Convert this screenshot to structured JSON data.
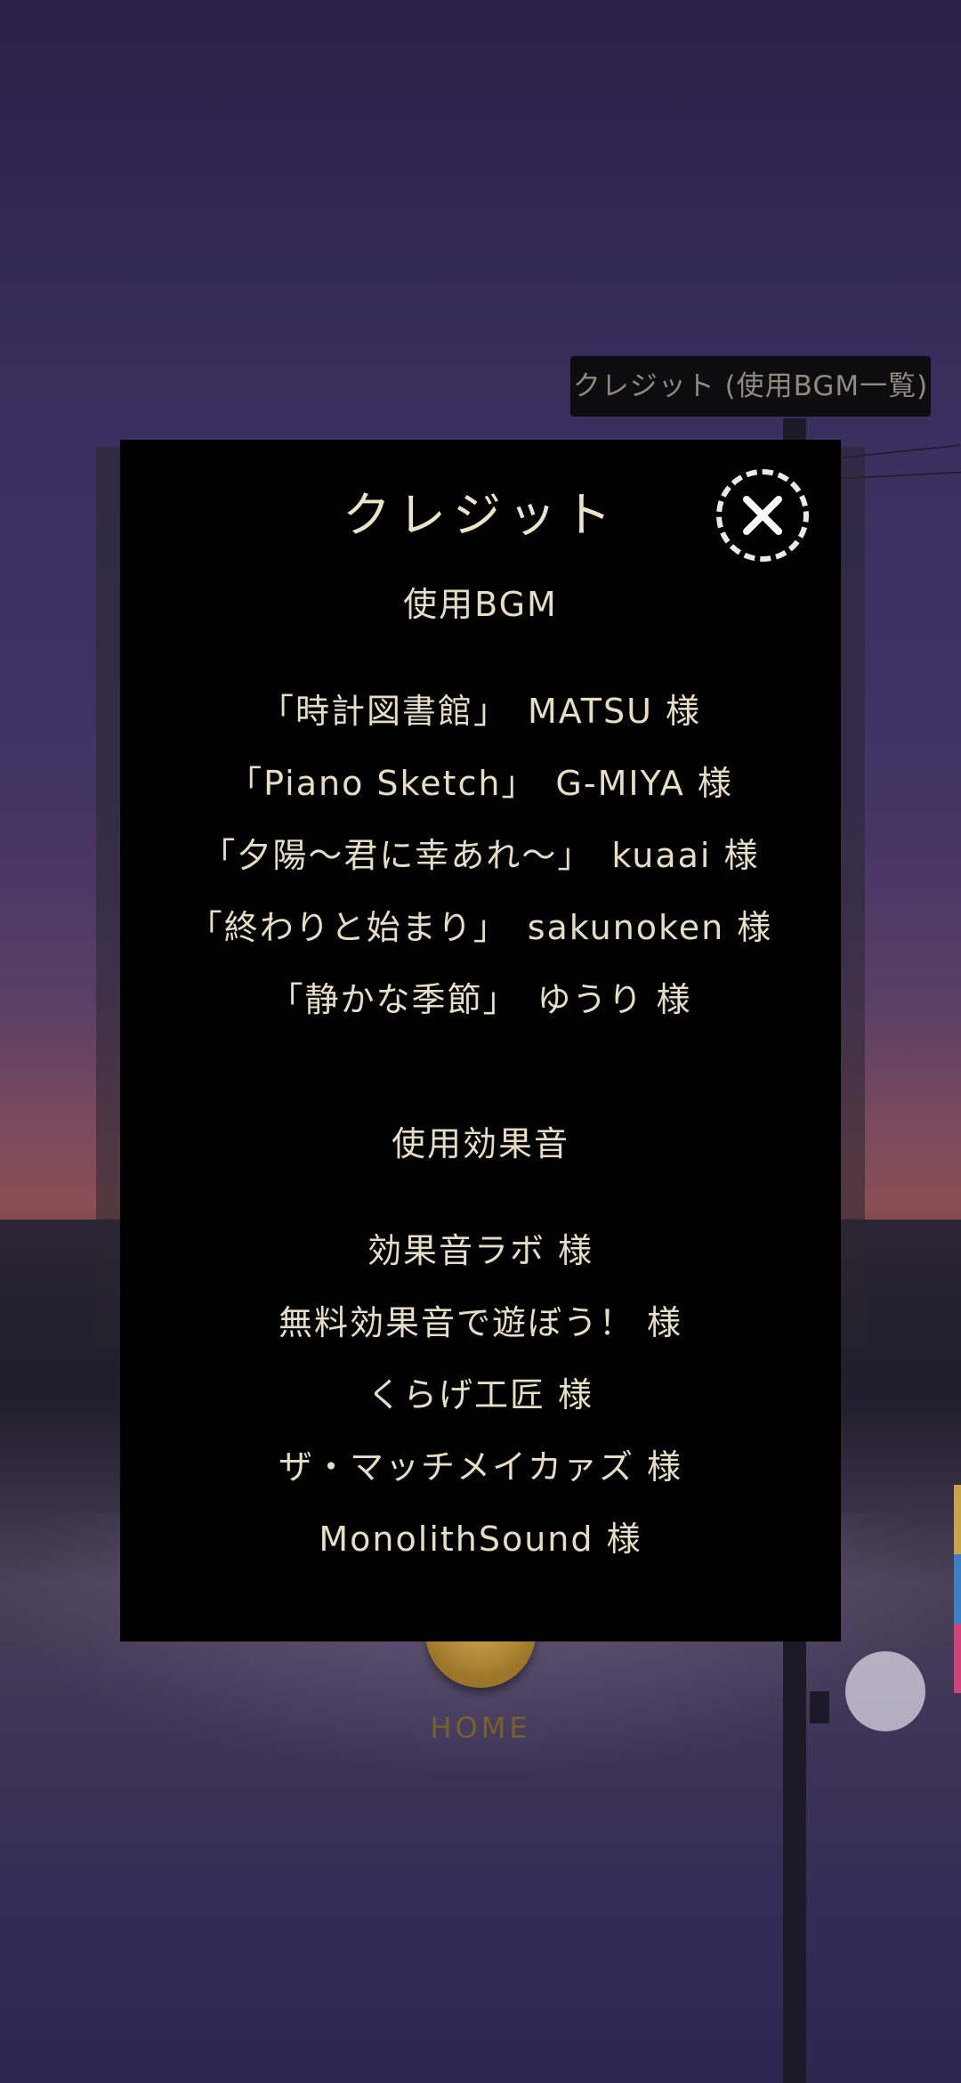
{
  "chip": {
    "label": "クレジット (使用BGM一覧)"
  },
  "modal": {
    "title": "クレジット",
    "close_icon": "close-x-icon",
    "bgm_heading": "使用BGM",
    "bgm_credits": [
      "「時計図書館」　MATSU 様",
      "「Piano Sketch」　G-MIYA 様",
      "「夕陽～君に幸あれ～」　kuaai 様",
      "「終わりと始まり」　sakunoken 様",
      "「静かな季節」　ゆうり 様"
    ],
    "se_heading": "使用効果音",
    "se_credits": [
      "効果音ラボ 様",
      "無料効果音で遊ぼう！ 様",
      "くらげ工匠 様",
      "ザ・マッチメイカァズ 様",
      "MonolithSound 様"
    ]
  },
  "home": {
    "label": "HOME"
  },
  "colors": {
    "modal_bg": "#000000",
    "text": "#e6ddc3",
    "accent_gold": "#c9a24b",
    "tab_colors": [
      "#c9a24b",
      "#3a7fc4",
      "#d0437a"
    ]
  }
}
